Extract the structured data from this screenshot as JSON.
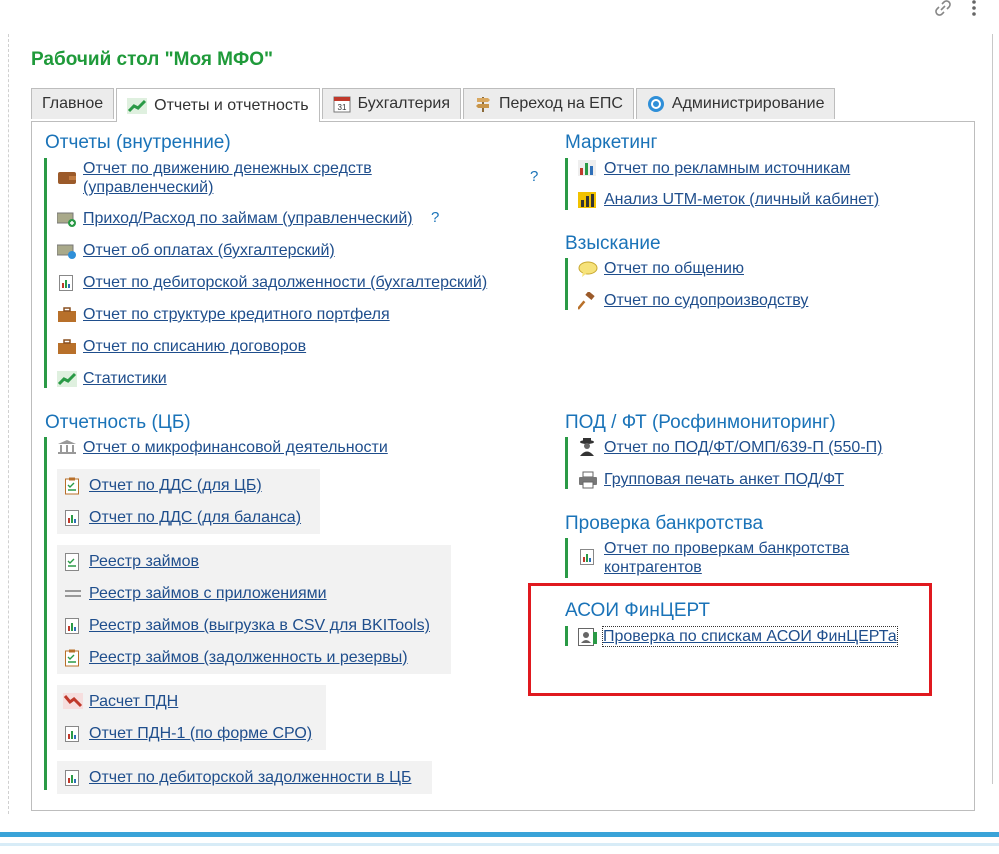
{
  "page_title": "Рабочий стол \"Моя МФО\"",
  "toolbar": {
    "link_icon": "link-icon",
    "menu_icon": "more-vertical-icon"
  },
  "tabs": [
    {
      "label": "Главное",
      "active": false
    },
    {
      "label": "Отчеты и отчетность",
      "active": true,
      "icon": "chart-up-icon"
    },
    {
      "label": "Бухгалтерия",
      "active": false,
      "icon": "calendar-icon"
    },
    {
      "label": "Переход на ЕПС",
      "active": false,
      "icon": "signpost-icon"
    },
    {
      "label": "Администрирование",
      "active": false,
      "icon": "gear-icon"
    }
  ],
  "sections": {
    "reports_internal": {
      "title": "Отчеты (внутренние)",
      "items": [
        {
          "label": "Отчет по движению денежных средств (управленческий)",
          "icon": "wallet-icon",
          "help": "?"
        },
        {
          "label": "Приход/Расход по займам (управленческий)",
          "icon": "money-plus-icon",
          "help": "?"
        },
        {
          "label": "Отчет об оплатах (бухгалтерский)",
          "icon": "money-icon"
        },
        {
          "label": "Отчет по дебиторской задолженности (бухгалтерский)",
          "icon": "report-icon"
        },
        {
          "label": "Отчет по структуре кредитного портфеля",
          "icon": "briefcase-icon"
        },
        {
          "label": "Отчет по списанию договоров",
          "icon": "briefcase-icon"
        },
        {
          "label": "Статистики",
          "icon": "chart-up-icon"
        }
      ]
    },
    "reporting_cb": {
      "title": "Отчетность (ЦБ)",
      "items": [
        {
          "label": "Отчет о микрофинансовой деятельности",
          "icon": "bank-icon"
        },
        {
          "label": "Отчет по ДДС (для ЦБ)",
          "icon": "clipboard-check-icon"
        },
        {
          "label": "Отчет по ДДС (для баланса)",
          "icon": "report-icon"
        },
        {
          "label": "Реестр займов",
          "icon": "document-check-icon"
        },
        {
          "label": "Реестр займов с приложениями",
          "icon": "lines-icon"
        },
        {
          "label": "Реестр займов (выгрузка в CSV для BKITools)",
          "icon": "report-icon"
        },
        {
          "label": "Реестр займов (задолженность и резервы)",
          "icon": "clipboard-check-icon"
        },
        {
          "label": "Расчет ПДН",
          "icon": "chart-down-icon"
        },
        {
          "label": "Отчет ПДН-1 (по форме СРО)",
          "icon": "report-icon"
        },
        {
          "label": "Отчет по дебиторской задолженности в ЦБ",
          "icon": "report-icon"
        }
      ]
    },
    "marketing": {
      "title": "Маркетинг",
      "items": [
        {
          "label": "Отчет по рекламным источникам",
          "icon": "bar-chart-icon"
        },
        {
          "label": "Анализ UTM-меток (личный кабинет)",
          "icon": "yellow-chart-icon"
        }
      ]
    },
    "collection": {
      "title": "Взыскание",
      "items": [
        {
          "label": "Отчет по общению",
          "icon": "speech-bubble-icon"
        },
        {
          "label": "Отчет по судопроизводству",
          "icon": "gavel-icon"
        }
      ]
    },
    "pod_ft": {
      "title": "ПОД / ФТ (Росфинмониторинг)",
      "items": [
        {
          "label": "Отчет по ПОД/ФТ/ОМП/639-П (550-П)",
          "icon": "spy-icon"
        },
        {
          "label": "Групповая печать анкет ПОД/ФТ",
          "icon": "printer-icon"
        }
      ]
    },
    "bankruptcy": {
      "title": "Проверка банкротства",
      "items": [
        {
          "label": "Отчет по проверкам банкротства контрагентов",
          "icon": "report-icon"
        }
      ]
    },
    "asoi": {
      "title": "АСОИ ФинЦЕРТ",
      "items": [
        {
          "label": "Проверка по спискам АСОИ ФинЦЕРТа",
          "icon": "id-card-icon"
        }
      ]
    }
  },
  "colors": {
    "title_green": "#1f9a3a",
    "section_blue": "#1a73b8",
    "link": "#1f4e8c",
    "bar_green": "#2a9a46",
    "highlight_red": "#e0191f"
  }
}
